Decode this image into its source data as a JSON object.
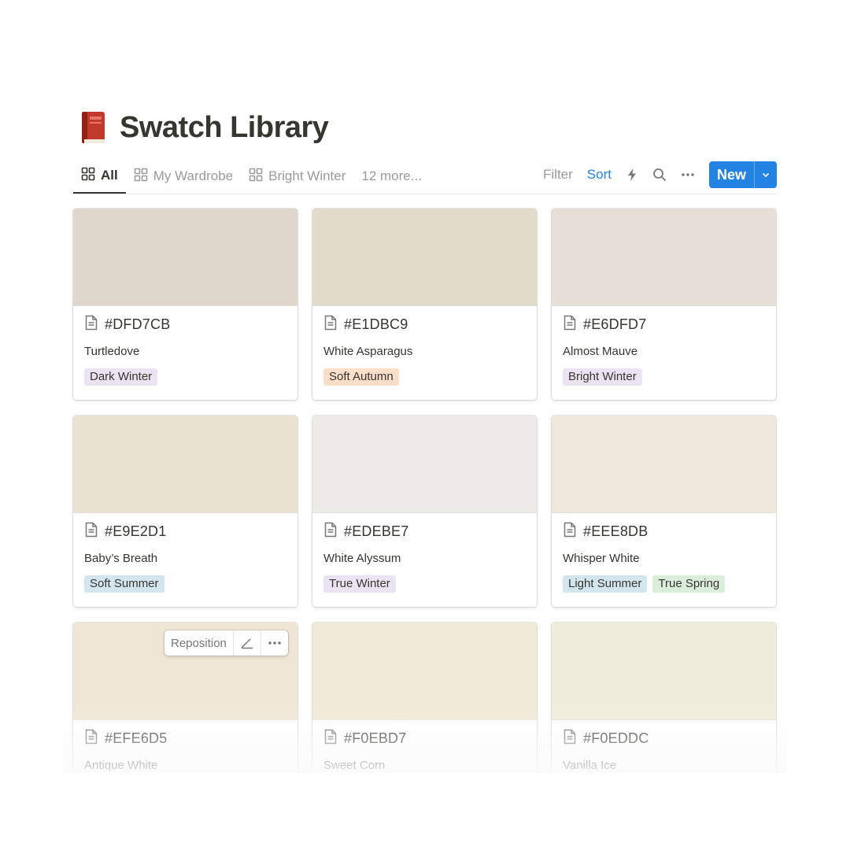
{
  "page": {
    "icon": "red-book-icon",
    "title": "Swatch Library"
  },
  "tabs": [
    {
      "label": "All",
      "icon": "gallery-grid-icon",
      "active": true
    },
    {
      "label": "My Wardrobe",
      "icon": "gallery-grid-icon",
      "active": false
    },
    {
      "label": "Bright Winter",
      "icon": "gallery-grid-icon",
      "active": false
    }
  ],
  "more_views": "12 more...",
  "actions": {
    "filter": "Filter",
    "sort": "Sort",
    "automation_icon": "lightning-icon",
    "search_icon": "search-icon",
    "more_icon": "ellipsis-icon",
    "new_label": "New",
    "new_caret_icon": "chevron-down-icon"
  },
  "colors": {
    "accent": "#2383E2",
    "text": "#37352F",
    "muted": "#9B9A97"
  },
  "cards": [
    {
      "hex": "#DFD7CB",
      "swatch": "#DFD7CB",
      "name": "Turtledove",
      "tags": [
        {
          "label": "Dark Winter",
          "color": "#EAE4F2"
        }
      ]
    },
    {
      "hex": "#E1DBC9",
      "swatch": "#E1DBC9",
      "name": "White Asparagus",
      "tags": [
        {
          "label": "Soft Autumn",
          "color": "#FADEC9"
        }
      ]
    },
    {
      "hex": "#E6DFD7",
      "swatch": "#E6DFD7",
      "name": "Almost Mauve",
      "tags": [
        {
          "label": "Bright Winter",
          "color": "#EAE4F2"
        }
      ]
    },
    {
      "hex": "#E9E2D1",
      "swatch": "#E9E2D1",
      "name": "Baby’s Breath",
      "tags": [
        {
          "label": "Soft Summer",
          "color": "#D3E5EF"
        }
      ]
    },
    {
      "hex": "#EDEBE7",
      "swatch": "#EDEBE7",
      "name": "White Alyssum",
      "tags": [
        {
          "label": "True Winter",
          "color": "#EAE4F2"
        }
      ]
    },
    {
      "hex": "#EEE8DB",
      "swatch": "#EEE8DB",
      "name": "Whisper White",
      "tags": [
        {
          "label": "Light Summer",
          "color": "#D3E5EF"
        },
        {
          "label": "True Spring",
          "color": "#DBEDDB"
        }
      ]
    },
    {
      "hex": "#EFE6D5",
      "swatch": "#EFE6D5",
      "name": "Antique White",
      "tags": []
    },
    {
      "hex": "#F0EBD7",
      "swatch": "#F0EBD7",
      "name": "Sweet Corn",
      "tags": []
    },
    {
      "hex": "#F0EDDC",
      "swatch": "#F0EDDC",
      "name": "Vanilla Ice",
      "tags": []
    }
  ],
  "cover_menu": {
    "reposition": "Reposition",
    "edit_icon": "pencil-icon",
    "more_icon": "ellipsis-icon"
  }
}
